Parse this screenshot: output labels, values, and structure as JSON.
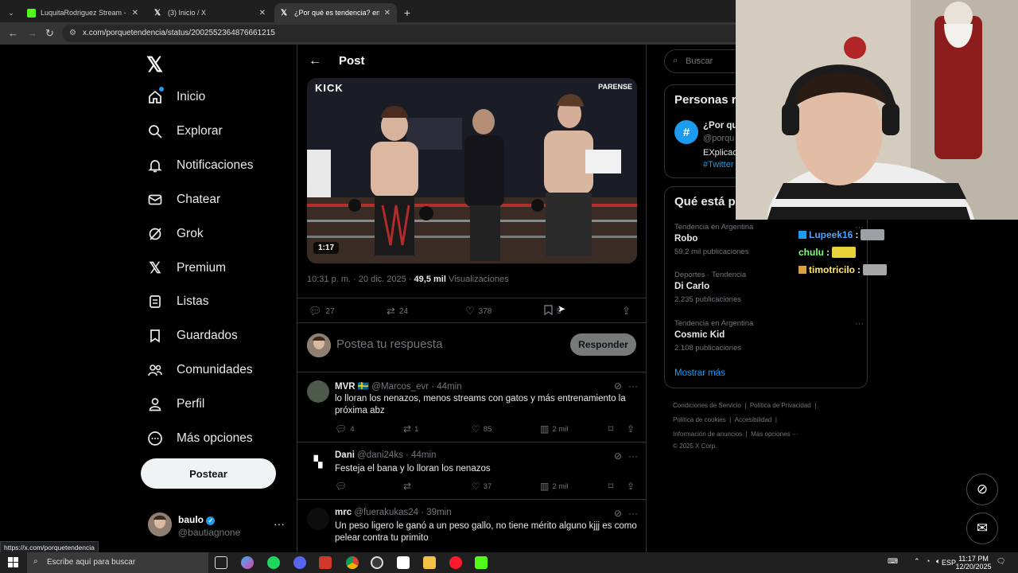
{
  "browser": {
    "tabs": [
      {
        "title": "LuquitaRodriguez Stream -",
        "active": false
      },
      {
        "title": "(3) Inicio / X",
        "active": false
      },
      {
        "title": "¿Por qué es tendencia? en X: \"",
        "active": true
      }
    ],
    "new_tab": "+",
    "url": "x.com/porquetendencia/status/2002552364876661215",
    "status_url": "https://x.com/porquetendencia"
  },
  "sidebar": {
    "items": [
      {
        "label": "Inicio",
        "icon": "home-icon"
      },
      {
        "label": "Explorar",
        "icon": "search-icon"
      },
      {
        "label": "Notificaciones",
        "icon": "bell-icon"
      },
      {
        "label": "Chatear",
        "icon": "mail-icon"
      },
      {
        "label": "Grok",
        "icon": "grok-icon"
      },
      {
        "label": "Premium",
        "icon": "x-logo-icon"
      },
      {
        "label": "Listas",
        "icon": "list-icon"
      },
      {
        "label": "Guardados",
        "icon": "bookmark-icon"
      },
      {
        "label": "Comunidades",
        "icon": "people-icon"
      },
      {
        "label": "Perfil",
        "icon": "person-icon"
      },
      {
        "label": "Más opciones",
        "icon": "more-circle-icon"
      }
    ],
    "post_button": "Postear",
    "profile": {
      "name": "baulo",
      "handle": "@bautiagnone"
    }
  },
  "post": {
    "header": "Post",
    "video": {
      "brand": "KICK",
      "brand2": "PARENSE",
      "duration": "1:17"
    },
    "timestamp": "10:31 p. m. · 20 dic. 2025 · ",
    "views": "49,5 mil",
    "views_label": "Visualizaciones",
    "stats": {
      "replies": "27",
      "reposts": "24",
      "likes": "378",
      "bookmarks": "5"
    },
    "reply_placeholder": "Postea tu respuesta",
    "reply_button": "Responder"
  },
  "replies": [
    {
      "name": "MVR",
      "flag": "🇸🇪",
      "handle": "@Marcos_evr",
      "time": "· 44min",
      "text": "lo lloran los nenazos, menos streams con gatos y más entrenamiento la próxima abz",
      "replies": "4",
      "reposts": "1",
      "likes": "85",
      "views": "2 mil"
    },
    {
      "name": "Dani",
      "flag": "",
      "handle": "@dani24ks",
      "time": "· 44min",
      "text": "Festeja el bana y lo lloran los nenazos",
      "replies": "",
      "reposts": "",
      "likes": "37",
      "views": "2 mil"
    },
    {
      "name": "mrc",
      "flag": "",
      "handle": "@fuerakukas24",
      "time": "· 39min",
      "text": "Un peso ligero le ganó a un peso gallo, no tiene mérito alguno kjjj es como pelear contra tu primito",
      "replies": "",
      "reposts": "",
      "likes": "",
      "views": ""
    }
  ],
  "right": {
    "search_placeholder": "Buscar",
    "who_to_follow": {
      "title": "Personas r",
      "name": "¿Por qu",
      "handle": "@porqu",
      "bio1": "EXplicac",
      "bio2": "#Twitter"
    },
    "trends_title": "Qué está pa",
    "trends": [
      {
        "category": "Tendencia en Argentina",
        "name": "Robo",
        "count": "59,2 mil publicaciones"
      },
      {
        "category": "Deportes · Tendencia",
        "name": "Di Carlo",
        "count": "2.235 publicaciones"
      },
      {
        "category": "Tendencia en Argentina",
        "name": "Cosmic Kid",
        "count": "2.108 publicaciones"
      }
    ],
    "show_more": "Mostrar más",
    "footer": [
      [
        "Condiciones de Servicio",
        "|",
        "Política de Privacidad",
        "|"
      ],
      [
        "Política de cookies",
        "|",
        "Accesibilidad",
        "|"
      ],
      [
        "Información de anuncios",
        "|",
        "Más opciones ···"
      ],
      [
        "© 2025 X Corp."
      ]
    ]
  },
  "chat": [
    {
      "user": "Lupeek16",
      "color": "#4fa3ff"
    },
    {
      "user": "chulu",
      "color": "#7dff7d"
    },
    {
      "user": "timotricilo",
      "color": "#ffe96b"
    }
  ],
  "taskbar": {
    "search_placeholder": "Escribe aquí para buscar",
    "lang": "ESP",
    "time": "11:17 PM",
    "date": "12/20/2025"
  }
}
